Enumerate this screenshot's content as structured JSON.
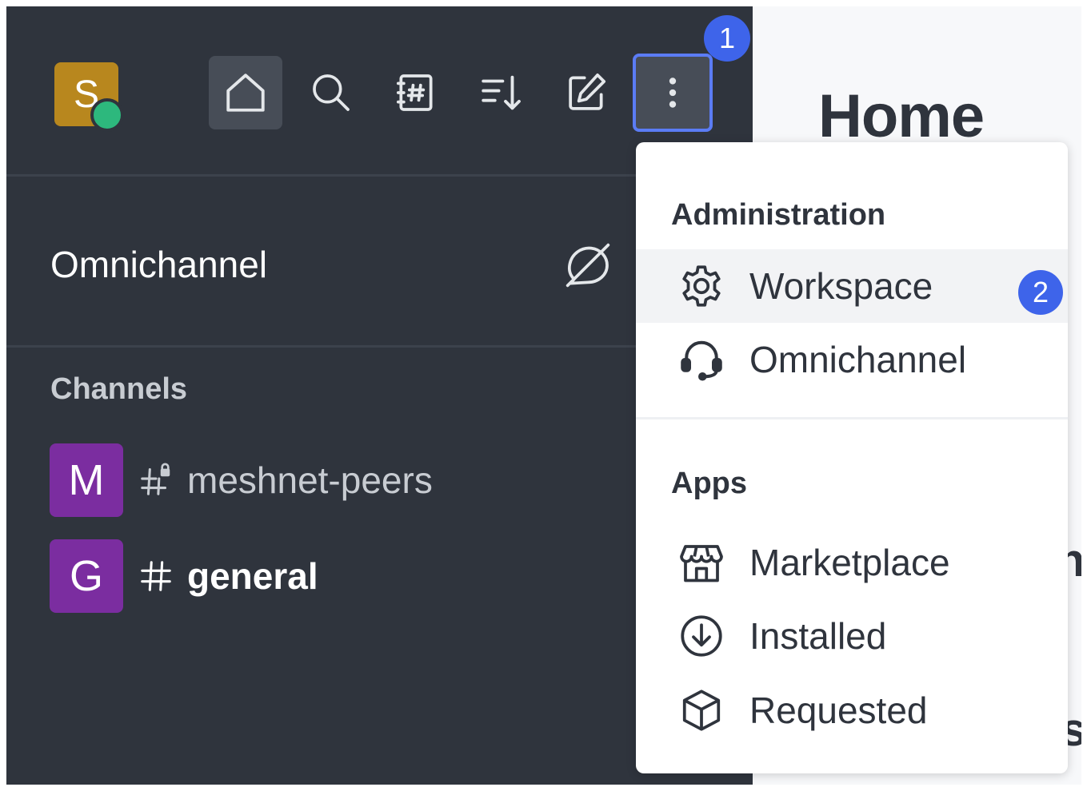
{
  "user": {
    "initial": "S",
    "status_color": "#2db87d"
  },
  "toolbar": {
    "buttons": [
      {
        "name": "home",
        "icon": "home-icon"
      },
      {
        "name": "search",
        "icon": "search-icon"
      },
      {
        "name": "directory",
        "icon": "directory-icon"
      },
      {
        "name": "sort",
        "icon": "sort-icon"
      },
      {
        "name": "create-new",
        "icon": "pencil-square-icon"
      },
      {
        "name": "administration-menu",
        "icon": "kebab-icon"
      }
    ]
  },
  "step_badges": [
    "1",
    "2"
  ],
  "sidebar": {
    "omnichannel_title": "Omnichannel",
    "channels_label": "Channels",
    "rooms": [
      {
        "initial": "M",
        "name": "meshnet-peers",
        "icon": "hashtag-lock-icon",
        "unread": false
      },
      {
        "initial": "G",
        "name": "general",
        "icon": "hashtag-icon",
        "unread": true
      }
    ]
  },
  "main": {
    "title": "Home"
  },
  "menu": {
    "groups": [
      {
        "title": "Administration",
        "items": [
          {
            "label": "Workspace",
            "icon": "gear-icon",
            "highlighted": true
          },
          {
            "label": "Omnichannel",
            "icon": "headset-icon",
            "highlighted": false
          }
        ]
      },
      {
        "title": "Apps",
        "items": [
          {
            "label": "Marketplace",
            "icon": "store-icon",
            "highlighted": false
          },
          {
            "label": "Installed",
            "icon": "download-circle-icon",
            "highlighted": false
          },
          {
            "label": "Requested",
            "icon": "cube-icon",
            "highlighted": false
          }
        ]
      }
    ]
  },
  "colors": {
    "sidebar_bg": "#2f343d",
    "accent": "#3e64ea",
    "focus_ring": "#5b7cf5",
    "room_avatar": "#7b2da0",
    "user_avatar": "#b8871e"
  }
}
